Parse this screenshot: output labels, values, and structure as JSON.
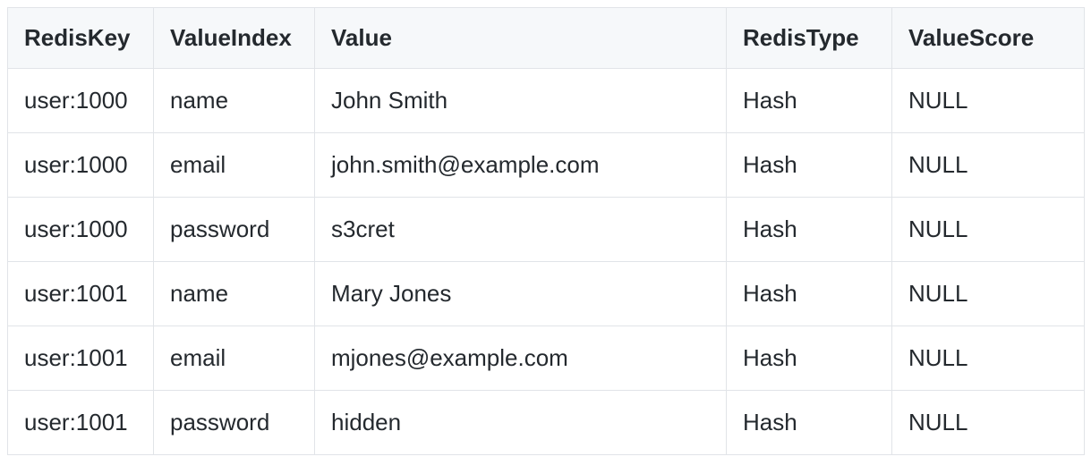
{
  "table": {
    "columns": [
      "RedisKey",
      "ValueIndex",
      "Value",
      "RedisType",
      "ValueScore"
    ],
    "rows": [
      {
        "RedisKey": "user:1000",
        "ValueIndex": "name",
        "Value": "John Smith",
        "RedisType": "Hash",
        "ValueScore": "NULL"
      },
      {
        "RedisKey": "user:1000",
        "ValueIndex": "email",
        "Value": "john.smith@example.com",
        "RedisType": "Hash",
        "ValueScore": "NULL"
      },
      {
        "RedisKey": "user:1000",
        "ValueIndex": "password",
        "Value": "s3cret",
        "RedisType": "Hash",
        "ValueScore": "NULL"
      },
      {
        "RedisKey": "user:1001",
        "ValueIndex": "name",
        "Value": "Mary Jones",
        "RedisType": "Hash",
        "ValueScore": "NULL"
      },
      {
        "RedisKey": "user:1001",
        "ValueIndex": "email",
        "Value": "mjones@example.com",
        "RedisType": "Hash",
        "ValueScore": "NULL"
      },
      {
        "RedisKey": "user:1001",
        "ValueIndex": "password",
        "Value": "hidden",
        "RedisType": "Hash",
        "ValueScore": "NULL"
      }
    ]
  }
}
